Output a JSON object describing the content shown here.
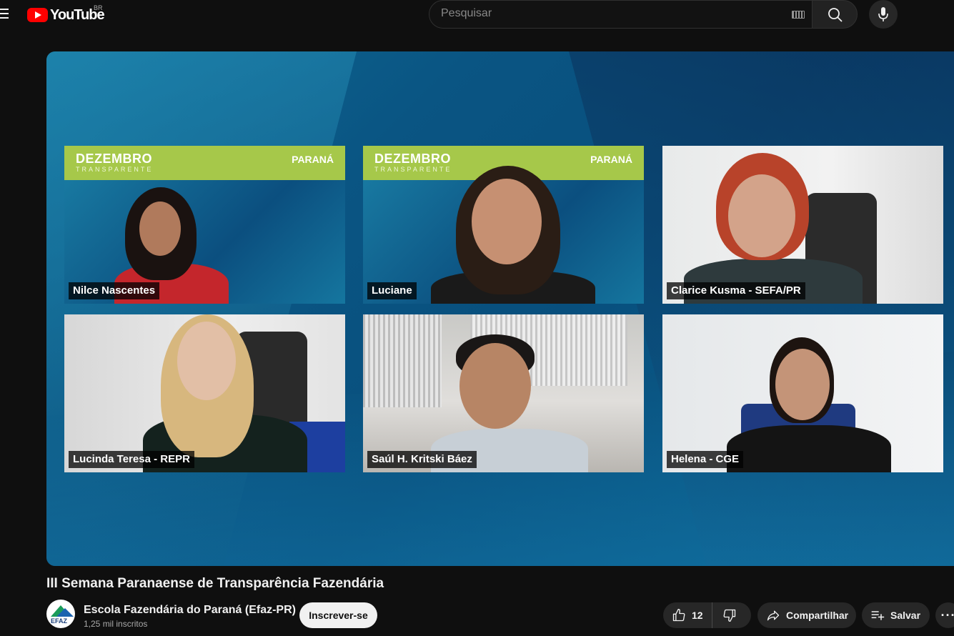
{
  "header": {
    "logo_text": "YouTube",
    "country_code": "BR",
    "search_placeholder": "Pesquisar"
  },
  "video": {
    "title": "III Semana Paranaense de Transparência Fazendária",
    "banner": {
      "line1": "DEZEMBRO",
      "line2": "TRANSPARENTE",
      "brand": "PARANÁ"
    },
    "participants": [
      {
        "name": "Nilce Nascentes"
      },
      {
        "name": "Luciane"
      },
      {
        "name": "Clarice Kusma - SEFA/PR"
      },
      {
        "name": "Lucinda Teresa - REPR"
      },
      {
        "name": "Saúl H. Kritski Báez"
      },
      {
        "name": "Helena - CGE"
      }
    ]
  },
  "channel": {
    "avatar_text": "EFAZ",
    "name": "Escola Fazendária do Paraná (Efaz-PR)",
    "subscribers": "1,25 mil inscritos",
    "subscribe_label": "Inscrever-se"
  },
  "actions": {
    "like_count": "12",
    "share_label": "Compartilhar",
    "save_label": "Salvar",
    "more_label": "···"
  },
  "colors": {
    "brand_red": "#ff0000",
    "banner_green": "#a6c84a",
    "background": "#0f0f0f"
  }
}
